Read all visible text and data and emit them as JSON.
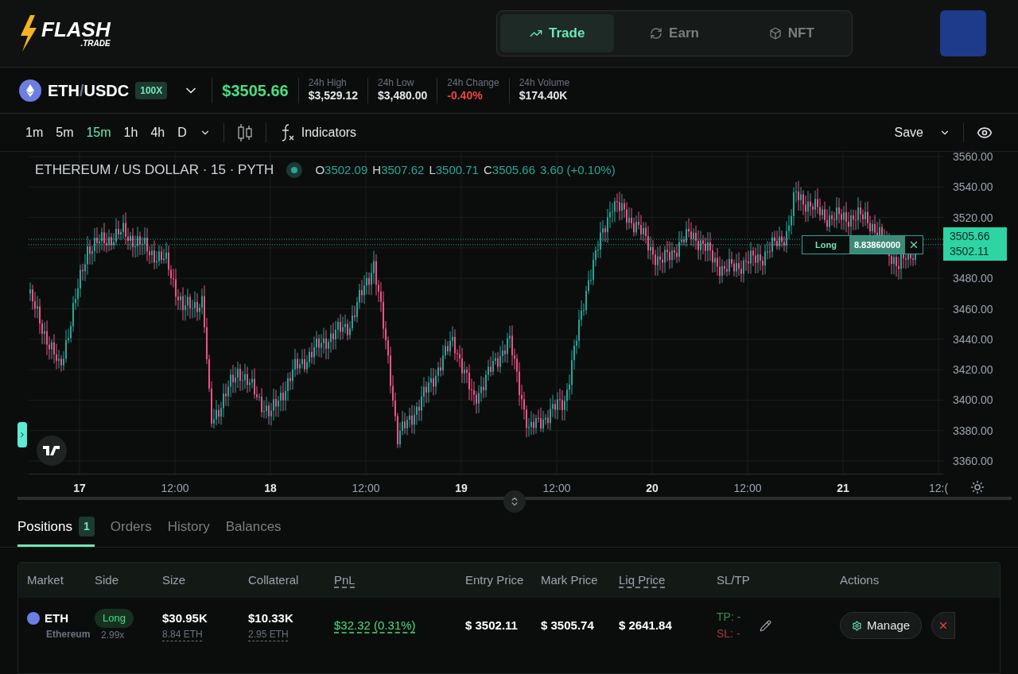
{
  "header": {
    "logo": {
      "word": "FLASH",
      "sub": ".TRADE"
    },
    "nav": [
      {
        "label": "Trade",
        "selected": true
      },
      {
        "label": "Earn",
        "selected": false
      },
      {
        "label": "NFT",
        "selected": false
      }
    ]
  },
  "market": {
    "pair_base": "ETH",
    "pair_sep": "/",
    "pair_quote": "USDC",
    "leverage": "100X",
    "price": "$3505.66",
    "stats": [
      {
        "label": "24h High",
        "value": "$3,529.12",
        "negative": false
      },
      {
        "label": "24h Low",
        "value": "$3,480.00",
        "negative": false
      },
      {
        "label": "24h Change",
        "value": "-0.40%",
        "negative": true
      },
      {
        "label": "24h Volume",
        "value": "$174.40K",
        "negative": false
      }
    ]
  },
  "chart_toolbar": {
    "intervals": [
      {
        "label": "1m",
        "selected": false
      },
      {
        "label": "5m",
        "selected": false
      },
      {
        "label": "15m",
        "selected": true
      },
      {
        "label": "1h",
        "selected": false
      },
      {
        "label": "4h",
        "selected": false
      },
      {
        "label": "D",
        "selected": false
      }
    ],
    "indicators": "Indicators",
    "save": "Save"
  },
  "chart": {
    "symbol": "ETHEREUM / US DOLLAR · 15 · PYTH",
    "ohlc": [
      {
        "key": "O",
        "value": "3502.09"
      },
      {
        "key": "H",
        "value": "3507.62"
      },
      {
        "key": "L",
        "value": "3500.71"
      },
      {
        "key": "C",
        "value": "3505.66"
      }
    ],
    "change": "3.60 (+0.10%)",
    "y_labels": [
      "3560.00",
      "3540.00",
      "3520.00",
      "3480.00",
      "3460.00",
      "3440.00",
      "3420.00",
      "3400.00",
      "3380.00",
      "3360.00"
    ],
    "x_labels": [
      {
        "label": "17",
        "bold": true
      },
      {
        "label": "12:00",
        "bold": false
      },
      {
        "label": "18",
        "bold": true
      },
      {
        "label": "12:00",
        "bold": false
      },
      {
        "label": "19",
        "bold": true
      },
      {
        "label": "12:00",
        "bold": false
      },
      {
        "label": "20",
        "bold": true
      },
      {
        "label": "12:00",
        "bold": false
      },
      {
        "label": "21",
        "bold": true
      },
      {
        "label": "12:(",
        "bold": false
      }
    ],
    "order_line": {
      "side": "Long",
      "amount": "8.83860000"
    },
    "price_tags": [
      "3505.66",
      "3502.11"
    ]
  },
  "bottom": {
    "tabs": [
      {
        "label": "Positions",
        "count": "1",
        "selected": true
      },
      {
        "label": "Orders",
        "selected": false
      },
      {
        "label": "History",
        "selected": false
      },
      {
        "label": "Balances",
        "selected": false
      }
    ],
    "columns": [
      {
        "label": "Market",
        "dotted": false
      },
      {
        "label": "Side",
        "dotted": false
      },
      {
        "label": "Size",
        "dotted": false
      },
      {
        "label": "Collateral",
        "dotted": false
      },
      {
        "label": "PnL",
        "dotted": true
      },
      {
        "label": "Entry Price",
        "dotted": false
      },
      {
        "label": "Mark Price",
        "dotted": false
      },
      {
        "label": "Liq Price",
        "dotted": true
      },
      {
        "label": "SL/TP",
        "dotted": false
      },
      {
        "label": "Actions",
        "dotted": false
      }
    ],
    "rows": [
      {
        "symbol": "ETH",
        "name": "Ethereum",
        "side": "Long",
        "leverage": "2.99x",
        "size": "$30.95K",
        "size_eth": "8.84 ETH",
        "collateral": "$10.33K",
        "collateral_eth": "2.95 ETH",
        "pnl": "$32.32 (0.31%)",
        "pnl_positive": true,
        "entry": "$ 3502.11",
        "mark": "$ 3505.74",
        "liq": "$ 2641.84",
        "tp": "TP: -",
        "sl": "SL: -",
        "manage": "Manage"
      }
    ]
  }
}
